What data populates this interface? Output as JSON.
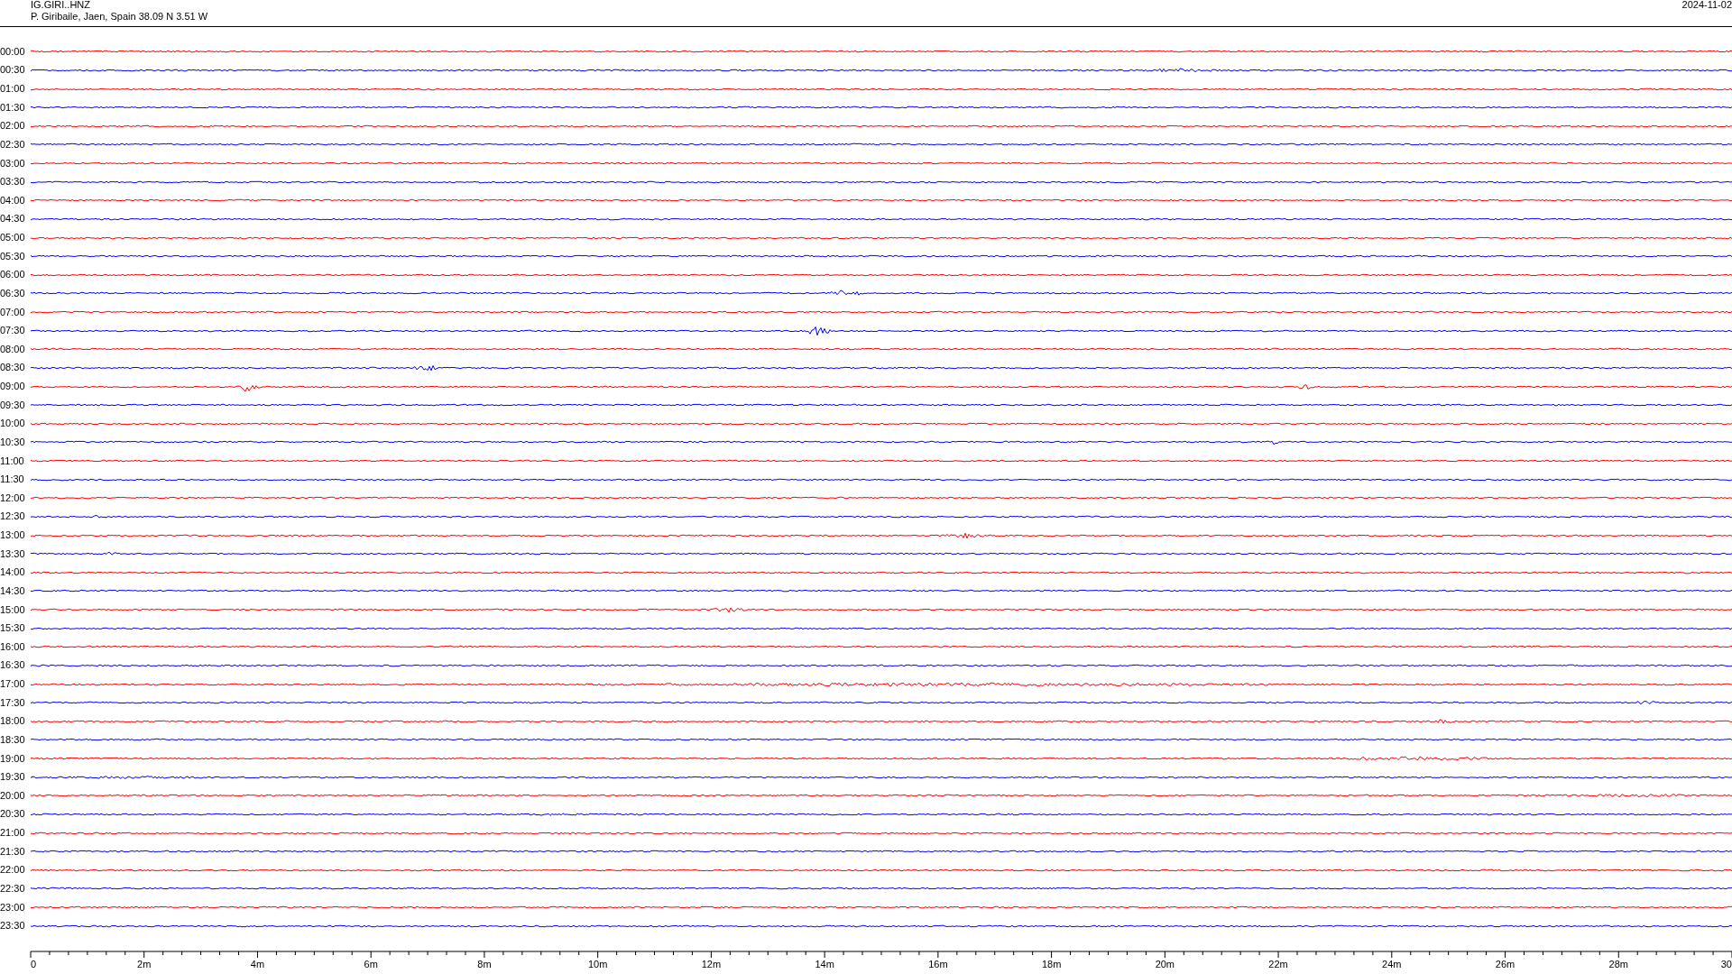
{
  "header": {
    "station": "IG.GIRI..HNZ",
    "location": "P. Giribaile, Jaen, Spain  38.09 N 3.51 W",
    "date": "2024-11-02"
  },
  "rows": [
    {
      "time": "00:00",
      "color": "#ff0000"
    },
    {
      "time": "00:30",
      "color": "#0000ff"
    },
    {
      "time": "01:00",
      "color": "#ff0000"
    },
    {
      "time": "01:30",
      "color": "#0000ff"
    },
    {
      "time": "02:00",
      "color": "#ff0000"
    },
    {
      "time": "02:30",
      "color": "#0000ff"
    },
    {
      "time": "03:00",
      "color": "#ff0000"
    },
    {
      "time": "03:30",
      "color": "#0000ff"
    },
    {
      "time": "04:00",
      "color": "#ff0000"
    },
    {
      "time": "04:30",
      "color": "#0000ff"
    },
    {
      "time": "05:00",
      "color": "#ff0000"
    },
    {
      "time": "05:30",
      "color": "#0000ff"
    },
    {
      "time": "06:00",
      "color": "#ff0000"
    },
    {
      "time": "06:30",
      "color": "#0000ff"
    },
    {
      "time": "07:00",
      "color": "#ff0000"
    },
    {
      "time": "07:30",
      "color": "#0000ff"
    },
    {
      "time": "08:00",
      "color": "#ff0000"
    },
    {
      "time": "08:30",
      "color": "#0000ff"
    },
    {
      "time": "09:00",
      "color": "#ff0000"
    },
    {
      "time": "09:30",
      "color": "#0000ff"
    },
    {
      "time": "10:00",
      "color": "#ff0000"
    },
    {
      "time": "10:30",
      "color": "#0000ff"
    },
    {
      "time": "11:00",
      "color": "#ff0000"
    },
    {
      "time": "11:30",
      "color": "#0000ff"
    },
    {
      "time": "12:00",
      "color": "#ff0000"
    },
    {
      "time": "12:30",
      "color": "#0000ff"
    },
    {
      "time": "13:00",
      "color": "#ff0000"
    },
    {
      "time": "13:30",
      "color": "#0000ff"
    },
    {
      "time": "14:00",
      "color": "#ff0000"
    },
    {
      "time": "14:30",
      "color": "#0000ff"
    },
    {
      "time": "15:00",
      "color": "#ff0000"
    },
    {
      "time": "15:30",
      "color": "#0000ff"
    },
    {
      "time": "16:00",
      "color": "#ff0000"
    },
    {
      "time": "16:30",
      "color": "#0000ff"
    },
    {
      "time": "17:00",
      "color": "#ff0000"
    },
    {
      "time": "17:30",
      "color": "#0000ff"
    },
    {
      "time": "18:00",
      "color": "#ff0000"
    },
    {
      "time": "18:30",
      "color": "#0000ff"
    },
    {
      "time": "19:00",
      "color": "#ff0000"
    },
    {
      "time": "19:30",
      "color": "#0000ff"
    },
    {
      "time": "20:00",
      "color": "#ff0000"
    },
    {
      "time": "20:30",
      "color": "#0000ff"
    },
    {
      "time": "21:00",
      "color": "#ff0000"
    },
    {
      "time": "21:30",
      "color": "#0000ff"
    },
    {
      "time": "22:00",
      "color": "#ff0000"
    },
    {
      "time": "22:30",
      "color": "#0000ff"
    },
    {
      "time": "23:00",
      "color": "#ff0000"
    },
    {
      "time": "23:30",
      "color": "#0000ff"
    }
  ],
  "x_axis": {
    "labels": [
      "0",
      "2m",
      "4m",
      "6m",
      "8m",
      "10m",
      "12m",
      "14m",
      "16m",
      "18m",
      "20m",
      "22m",
      "24m",
      "26m",
      "28m",
      "30"
    ]
  }
}
